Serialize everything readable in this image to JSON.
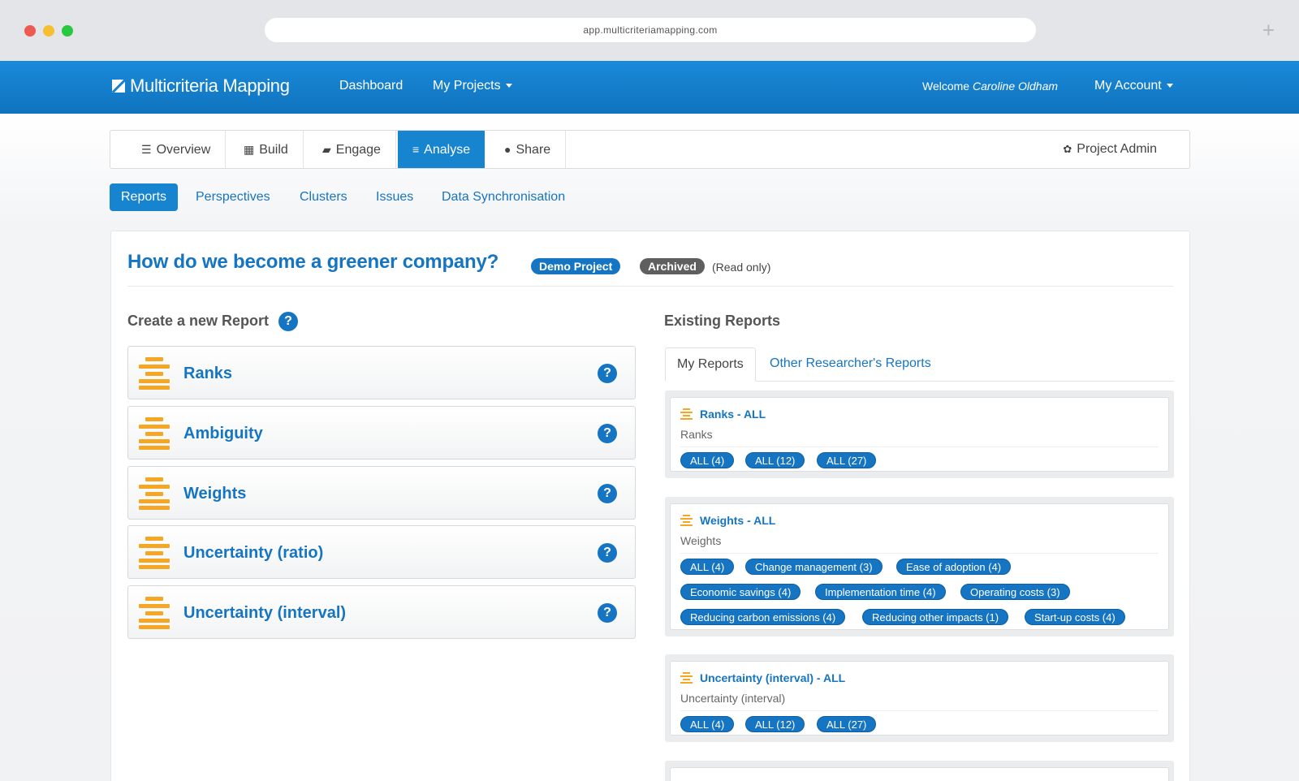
{
  "browser": {
    "url": "app.multicriteriamapping.com",
    "new_tab": "+"
  },
  "navbar": {
    "brand": "Multicriteria Mapping",
    "dashboard": "Dashboard",
    "my_projects": "My Projects",
    "welcome_prefix": "Welcome",
    "user_name": "Caroline Oldham",
    "my_account": "My Account"
  },
  "main_tabs": {
    "overview": "Overview",
    "build": "Build",
    "engage": "Engage",
    "analyse": "Analyse",
    "share": "Share",
    "project_admin": "Project Admin"
  },
  "sub_tabs": {
    "reports": "Reports",
    "perspectives": "Perspectives",
    "clusters": "Clusters",
    "issues": "Issues",
    "data_sync": "Data Synchronisation"
  },
  "project": {
    "title": "How do we become a greener company?",
    "badge_demo": "Demo Project",
    "badge_archived": "Archived",
    "read_only": "(Read only)"
  },
  "create": {
    "heading": "Create a new Report",
    "help": "?",
    "types": [
      "Ranks",
      "Ambiguity",
      "Weights",
      "Uncertainty (ratio)",
      "Uncertainty (interval)"
    ]
  },
  "existing": {
    "heading": "Existing Reports",
    "tab_mine": "My Reports",
    "tab_other": "Other Researcher's Reports",
    "reports": [
      {
        "title": "Ranks - ALL",
        "type": "Ranks",
        "pills": [
          "ALL (4)",
          "ALL (12)",
          "ALL (27)"
        ]
      },
      {
        "title": "Weights - ALL",
        "type": "Weights",
        "pills": [
          "ALL (4)",
          "Change management (3)",
          "Ease of adoption (4)",
          "Economic savings (4)",
          "Implementation time (4)",
          "Operating costs (3)",
          "Reducing carbon emissions (4)",
          "Reducing other impacts (1)",
          "Start-up costs (4)"
        ]
      },
      {
        "title": "Uncertainty (interval) - ALL",
        "type": "Uncertainty (interval)",
        "pills": [
          "ALL (4)",
          "ALL (12)",
          "ALL (27)"
        ]
      }
    ]
  },
  "colors": {
    "brand_blue": "#1575c2",
    "navbar": "#1584d0",
    "bars_orange": "#f5a623",
    "archived_gray": "#5f5f5f"
  }
}
